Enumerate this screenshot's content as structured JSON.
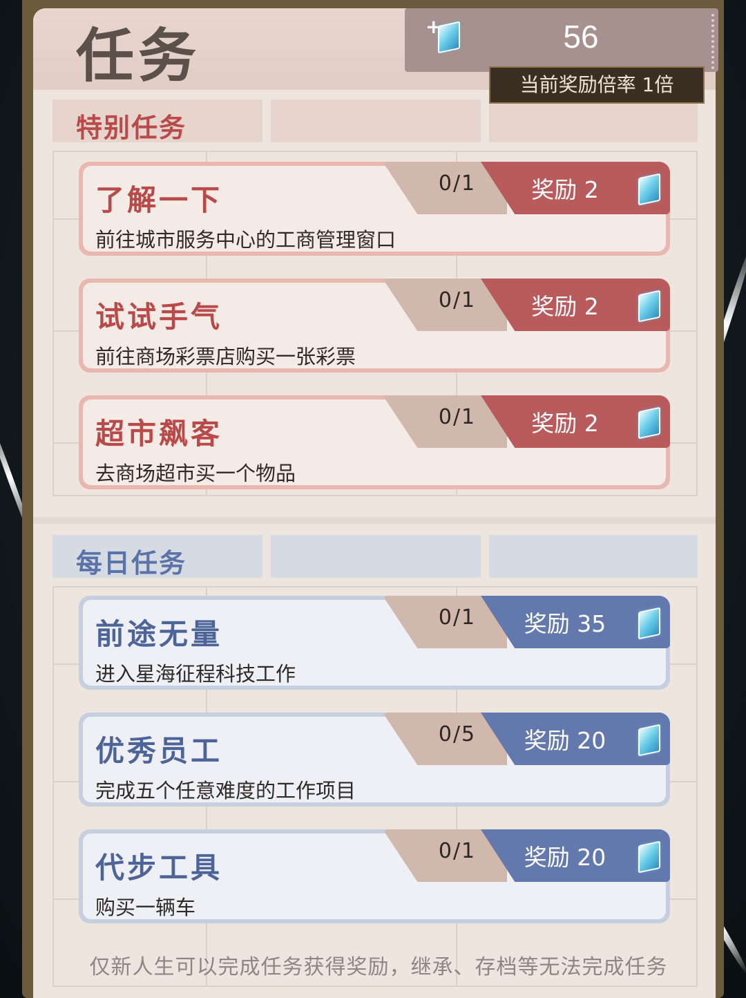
{
  "header": {
    "title": "任务",
    "currency_value": "56",
    "multiplier_text": "当前奖励倍率 1倍",
    "currency_icon": "crystal-icon",
    "add_icon": "plus-icon"
  },
  "special": {
    "section_title": "特别任务",
    "accent": "#b84a4a",
    "tasks": [
      {
        "title": "了解一下",
        "desc": "前往城市服务中心的工商管理窗口",
        "progress": "0/1",
        "reward": "奖励 2"
      },
      {
        "title": "试试手气",
        "desc": "前往商场彩票店购买一张彩票",
        "progress": "0/1",
        "reward": "奖励 2"
      },
      {
        "title": "超市飙客",
        "desc": "去商场超市买一个物品",
        "progress": "0/1",
        "reward": "奖励 2"
      }
    ]
  },
  "daily": {
    "section_title": "每日任务",
    "accent": "#5a73a8",
    "tasks": [
      {
        "title": "前途无量",
        "desc": "进入星海征程科技工作",
        "progress": "0/1",
        "reward": "奖励 35"
      },
      {
        "title": "优秀员工",
        "desc": "完成五个任意难度的工作项目",
        "progress": "0/5",
        "reward": "奖励 20"
      },
      {
        "title": "代步工具",
        "desc": "购买一辆车",
        "progress": "0/1",
        "reward": "奖励 20"
      }
    ]
  },
  "footer": {
    "note": "仅新人生可以完成任务获得奖励，继承、存档等无法完成任务"
  }
}
